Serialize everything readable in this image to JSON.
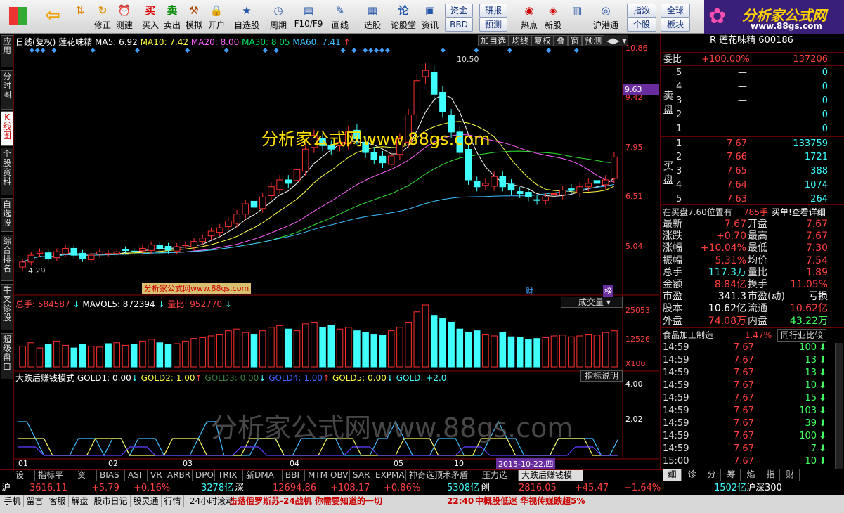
{
  "toolbar": {
    "buttons": [
      "修正",
      "测建",
      "买入",
      "卖出",
      "模拟",
      "开户",
      "自选股",
      "周期",
      "F10/F9",
      "画线",
      "选股",
      "论股堂",
      "资讯"
    ],
    "small_buttons": [
      "资金",
      "BBD",
      "研报",
      "预测",
      "热点",
      "新股",
      "沪港通",
      "指数",
      "全球",
      "个股",
      "板块"
    ],
    "icons": [
      "back-arrow-icon",
      "refresh-icon",
      "alarm-icon",
      "buy-icon",
      "sell-icon",
      "hammer-icon",
      "lock-icon",
      "star-icon",
      "clock-icon",
      "window-icon",
      "pen-icon",
      "pick-icon",
      "lun-icon",
      "news-icon"
    ]
  },
  "logo": {
    "title": "分析家公式网",
    "url": "www.88gs.com"
  },
  "left_tabs": [
    "应用",
    "分时图",
    "K线图",
    "个股资料",
    "自选股",
    "综合排名",
    "牛叉诊股",
    "超级盘口"
  ],
  "kline_header": {
    "title": "日线(复权)",
    "stock": "莲花味精",
    "ma5": "MA5: 6.92",
    "ma10": "MA10: 7.42",
    "ma20": "MA20: 8.00",
    "ma30": "MA30: 8.05",
    "ma60": "MA60: 7.41",
    "arrow": "↑"
  },
  "chart_top_buttons": [
    "加自选",
    "均线",
    "复权",
    "叠",
    "窗",
    "预测"
  ],
  "price_scale": [
    "10.86",
    "9.42",
    "7.95",
    "6.51",
    "5.04"
  ],
  "cursor_price": "9.63",
  "labels": {
    "high": "10.50",
    "low": "4.29",
    "watermark": "分析家公式网www.88gs.com",
    "watermark_small": "分析家公式网www.88gs.com",
    "watermark_big": "分析家公式网www.88gs.com",
    "cai": "财",
    "bang": "榜"
  },
  "vol_header": {
    "total": "总手: 584587",
    "mavol": "MAVOL5: 872394",
    "ratio": "量比: 952770",
    "arrow": "↓"
  },
  "vol_dropdown": "成交量",
  "vol_scale": [
    "25053",
    "12526",
    "X100"
  ],
  "ind_header": {
    "name": "大跌后赚钱模式",
    "g1": "GOLD1: 0.00",
    "g2": "GOLD2: 1.00",
    "g3": "GOLD3: 0.00",
    "g4": "GOLD4: 1.00",
    "g5": "GOLD5: 0.00",
    "g": "GOLD: +2.0"
  },
  "ind_button": "指标说明",
  "ind_scale": [
    "4.00",
    "2.02"
  ],
  "x_axis": [
    "01",
    "02",
    "03",
    "04",
    "05",
    "10"
  ],
  "x_date": "2015-10-22,四",
  "chart_data": {
    "type": "candlestick",
    "price_range": [
      4.29,
      10.86
    ],
    "close": [
      4.6,
      4.8,
      4.9,
      4.7,
      4.9,
      5.0,
      4.8,
      4.7,
      4.8,
      4.9,
      4.85,
      4.9,
      4.95,
      4.9,
      5.0,
      5.1,
      5.0,
      4.95,
      5.05,
      5.1,
      5.2,
      5.3,
      5.5,
      5.6,
      5.8,
      6.0,
      6.3,
      6.2,
      6.5,
      6.8,
      7.0,
      6.9,
      7.3,
      7.9,
      8.3,
      8.0,
      7.9,
      8.1,
      8.4,
      8.2,
      7.8,
      7.6,
      7.5,
      7.7,
      8.2,
      8.9,
      9.9,
      10.2,
      9.5,
      9.0,
      8.4,
      7.8,
      7.0,
      6.8,
      6.9,
      7.1,
      6.8,
      6.7,
      6.6,
      6.5,
      6.4,
      6.5,
      6.6,
      6.7,
      6.7,
      6.8,
      6.9,
      6.9,
      7.0,
      7.67
    ],
    "volume": [
      120,
      140,
      110,
      130,
      150,
      125,
      110,
      130,
      120,
      115,
      135,
      140,
      125,
      130,
      150,
      160,
      140,
      130,
      135,
      150,
      165,
      170,
      180,
      190,
      210,
      220,
      200,
      190,
      210,
      230,
      240,
      220,
      210,
      250,
      260,
      230,
      240,
      220,
      230,
      210,
      200,
      190,
      185,
      210,
      230,
      260,
      320,
      360,
      300,
      280,
      260,
      220,
      200,
      210,
      190,
      180,
      200,
      175,
      170,
      160,
      165,
      170,
      180,
      185,
      175,
      180,
      190,
      185,
      200,
      210
    ]
  },
  "quote": {
    "title": "R 莲花味精 600186",
    "weibi_label": "委比",
    "weibi": "+100.00%",
    "weicha": "137206",
    "sell": [
      [
        "5",
        "—",
        "0"
      ],
      [
        "4",
        "—",
        "0"
      ],
      [
        "3",
        "—",
        "0"
      ],
      [
        "2",
        "—",
        "0"
      ],
      [
        "1",
        "—",
        "0"
      ]
    ],
    "buy": [
      [
        "1",
        "7.67",
        "133759"
      ],
      [
        "2",
        "7.66",
        "1721"
      ],
      [
        "3",
        "7.65",
        "388"
      ],
      [
        "4",
        "7.64",
        "1074"
      ],
      [
        "5",
        "7.63",
        "264"
      ]
    ],
    "sell_label": "卖盘",
    "buy_label": "买盘",
    "zaimai": "在买盘7.60位置有",
    "zaimai_num": "785手",
    "zaimai_tip": "买单!查看详细",
    "stats": [
      [
        "最新",
        "7.67",
        "开盘",
        "7.67"
      ],
      [
        "涨跌",
        "+0.70",
        "最高",
        "7.67"
      ],
      [
        "涨幅",
        "+10.04%",
        "最低",
        "7.30"
      ],
      [
        "振幅",
        "5.31%",
        "均价",
        "7.54"
      ],
      [
        "总手",
        "117.3万",
        "量比",
        "1.89"
      ],
      [
        "金额",
        "8.84亿",
        "换手",
        "11.05%"
      ],
      [
        "市盈",
        "341.3",
        "市盈(动)",
        "亏损"
      ],
      [
        "股本",
        "10.62亿",
        "流通",
        "10.62亿"
      ],
      [
        "外盘",
        "74.08万",
        "内盘",
        "43.22万"
      ]
    ],
    "sector": "食品加工制造",
    "sector_pct": "1.47%",
    "sector_btn": "同行业比较",
    "ticks": [
      [
        "14:59",
        "7.67",
        "100"
      ],
      [
        "14:59",
        "7.67",
        "13"
      ],
      [
        "14:59",
        "7.67",
        "13"
      ],
      [
        "14:59",
        "7.67",
        "10"
      ],
      [
        "14:59",
        "7.67",
        "15"
      ],
      [
        "14:59",
        "7.67",
        "103"
      ],
      [
        "14:59",
        "7.67",
        "39"
      ],
      [
        "14:59",
        "7.67",
        "100"
      ],
      [
        "14:59",
        "7.67",
        "7"
      ],
      [
        "15:00",
        "7.67",
        "10"
      ]
    ],
    "right_tabs": [
      "细",
      "诊",
      "分",
      "筹",
      "焰",
      "指",
      "财"
    ]
  },
  "bottom_tabs": [
    "设置",
    "指标平台",
    "资讯",
    "BIAS",
    "ASI",
    "VR",
    "ARBR",
    "DPO",
    "TRIX",
    "新DMA",
    "BBI",
    "MTM",
    "OBV",
    "SAR",
    "EXPMA",
    "神奇选顶术矛盾线",
    "压力选股",
    "大跌后赚钱模式"
  ],
  "index_bar": {
    "sh": "沪",
    "sh_val": "3616.11",
    "sh_chg": "+5.79",
    "sh_pct": "+0.16%",
    "sh_amt": "3278亿",
    "sz": "深",
    "sz_val": "12694.86",
    "sz_chg": "+108.17",
    "sz_pct": "+0.86%",
    "sz_amt": "5308亿",
    "cy": "创",
    "cy_val": "2816.05",
    "cy_chg": "+45.47",
    "cy_pct": "+1.64%",
    "hs_amt": "1502亿",
    "hs": "沪深300"
  },
  "status": {
    "items": [
      "手机",
      "留言",
      "客服",
      "解盘",
      "股市日记",
      "股灵通",
      "行情",
      "24小时滚动"
    ],
    "news1": "击落俄罗斯苏-24战机 你需要知道的一切",
    "time": "22:40",
    "news2": "中概股低迷 华视传媒跌超5%"
  }
}
